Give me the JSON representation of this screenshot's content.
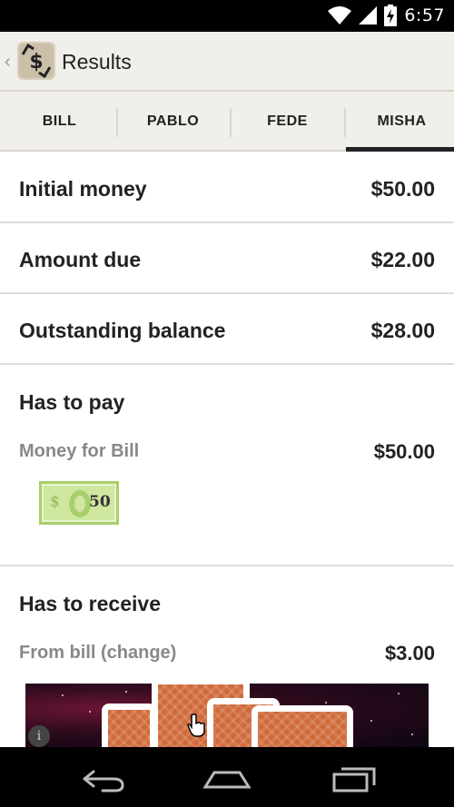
{
  "status_bar": {
    "time": "6:57",
    "icons": [
      "wifi-icon",
      "signal-icon",
      "battery-charging-icon"
    ]
  },
  "action_bar": {
    "title": "Results",
    "app_icon": "dollar-app-icon"
  },
  "tabs": [
    {
      "label": "BILL",
      "selected": false
    },
    {
      "label": "PABLO",
      "selected": false
    },
    {
      "label": "FEDE",
      "selected": false
    },
    {
      "label": "MISHA",
      "selected": true
    }
  ],
  "summary": [
    {
      "label": "Initial money",
      "value": "$50.00"
    },
    {
      "label": "Amount due",
      "value": "$22.00"
    },
    {
      "label": "Outstanding balance",
      "value": "$28.00"
    }
  ],
  "has_to_pay": {
    "title": "Has to pay",
    "item_label": "Money for Bill",
    "item_amount": "$50.00",
    "banknote": {
      "currency_symbol": "$",
      "denomination": "50"
    }
  },
  "has_to_receive": {
    "title": "Has to receive",
    "item_label": "From bill (change)",
    "item_amount": "$3.00"
  },
  "ad": {
    "info_glyph": "i"
  },
  "nav_bar": {
    "buttons": [
      "back-icon",
      "home-icon",
      "recents-icon"
    ]
  },
  "colors": {
    "accent": "#222222",
    "action_bar_bg": "#f1efea",
    "muted_text": "#888888",
    "banknote_green": "#cfe7a0"
  }
}
